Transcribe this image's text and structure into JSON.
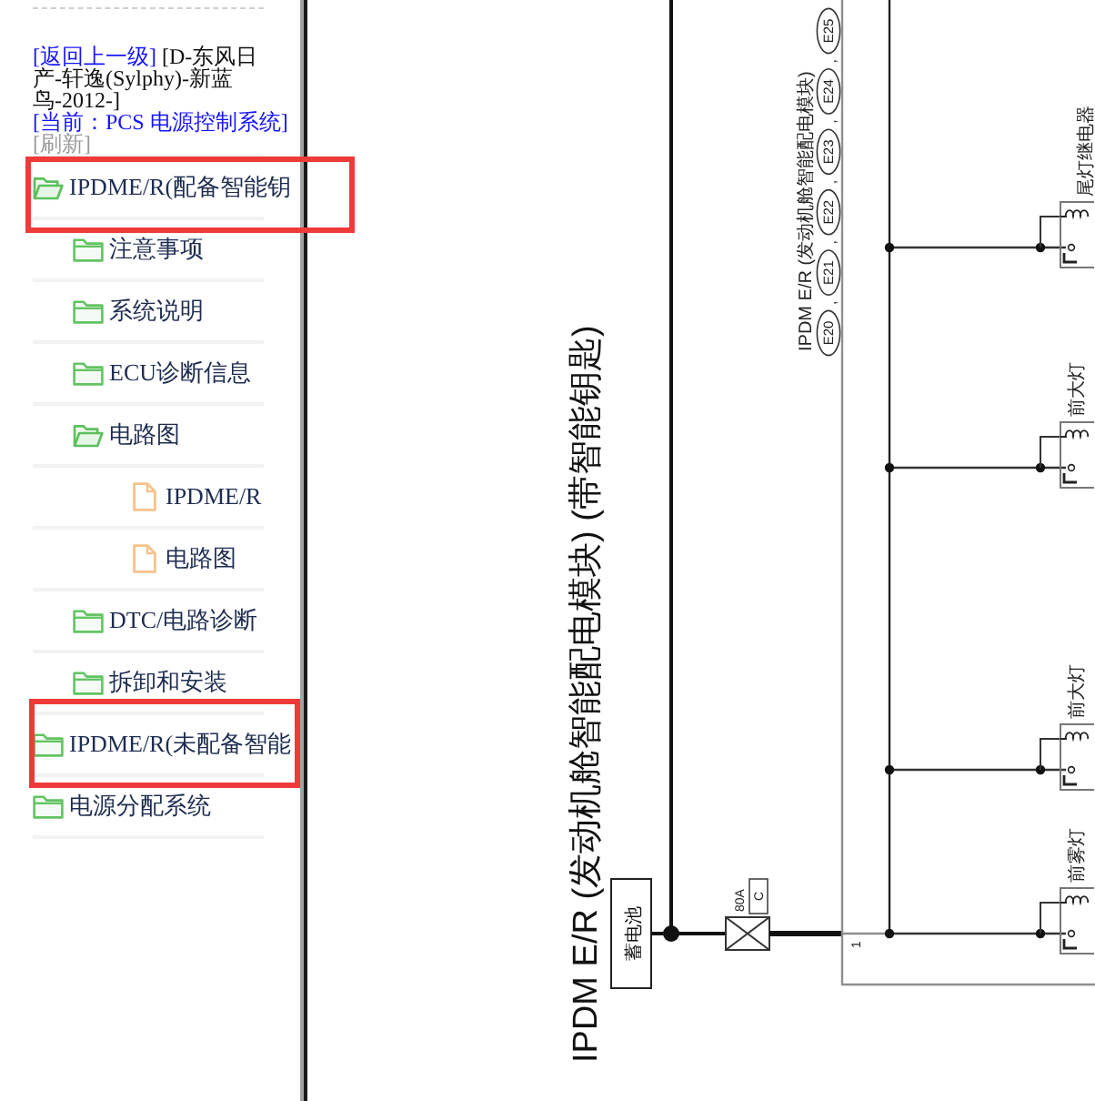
{
  "sidebar": {
    "back_link": "[返回上一级]",
    "vehicle_path": "[D-东风日产-轩逸(Sylphy)-新蓝鸟-2012-]",
    "current_page": "[当前：PCS 电源控制系统]",
    "refresh_link": "[刷新]",
    "tree": [
      {
        "label": "IPDME/R(配备智能钥",
        "kind": "folder",
        "expanded": true,
        "highlighted": true,
        "children": [
          {
            "label": "注意事项",
            "kind": "folder",
            "expanded": false
          },
          {
            "label": "系统说明",
            "kind": "folder",
            "expanded": false
          },
          {
            "label": "ECU诊断信息",
            "kind": "folder",
            "expanded": false
          },
          {
            "label": "电路图",
            "kind": "folder",
            "expanded": true,
            "children": [
              {
                "label": "IPDME/R",
                "kind": "file"
              },
              {
                "label": "电路图",
                "kind": "file"
              }
            ]
          },
          {
            "label": "DTC/电路诊断",
            "kind": "folder",
            "expanded": false
          },
          {
            "label": "拆卸和安装",
            "kind": "folder",
            "expanded": false
          }
        ]
      },
      {
        "label": "IPDME/R(未配备智能",
        "kind": "folder",
        "expanded": false,
        "highlighted": true
      },
      {
        "label": "电源分配系统",
        "kind": "folder",
        "expanded": false,
        "highlighted": false
      }
    ]
  },
  "diagram": {
    "title": "IPDM E/R (发动机舱智能配电模块) (带智能钥匙)",
    "module_label": "IPDM E/R (发动机舱智能配电模块)",
    "connectors": [
      "E20",
      "E21",
      "E22",
      "E23",
      "E24",
      "E25"
    ],
    "connector_separator": ",",
    "battery_label": "蓄电池",
    "fuse_rating": "80A",
    "fuse_location": "C",
    "terminal": "1",
    "relays": [
      {
        "label": "尾灯继电器"
      },
      {
        "label": "前大灯"
      },
      {
        "label": "前大灯"
      },
      {
        "label": "前雾灯"
      }
    ]
  }
}
